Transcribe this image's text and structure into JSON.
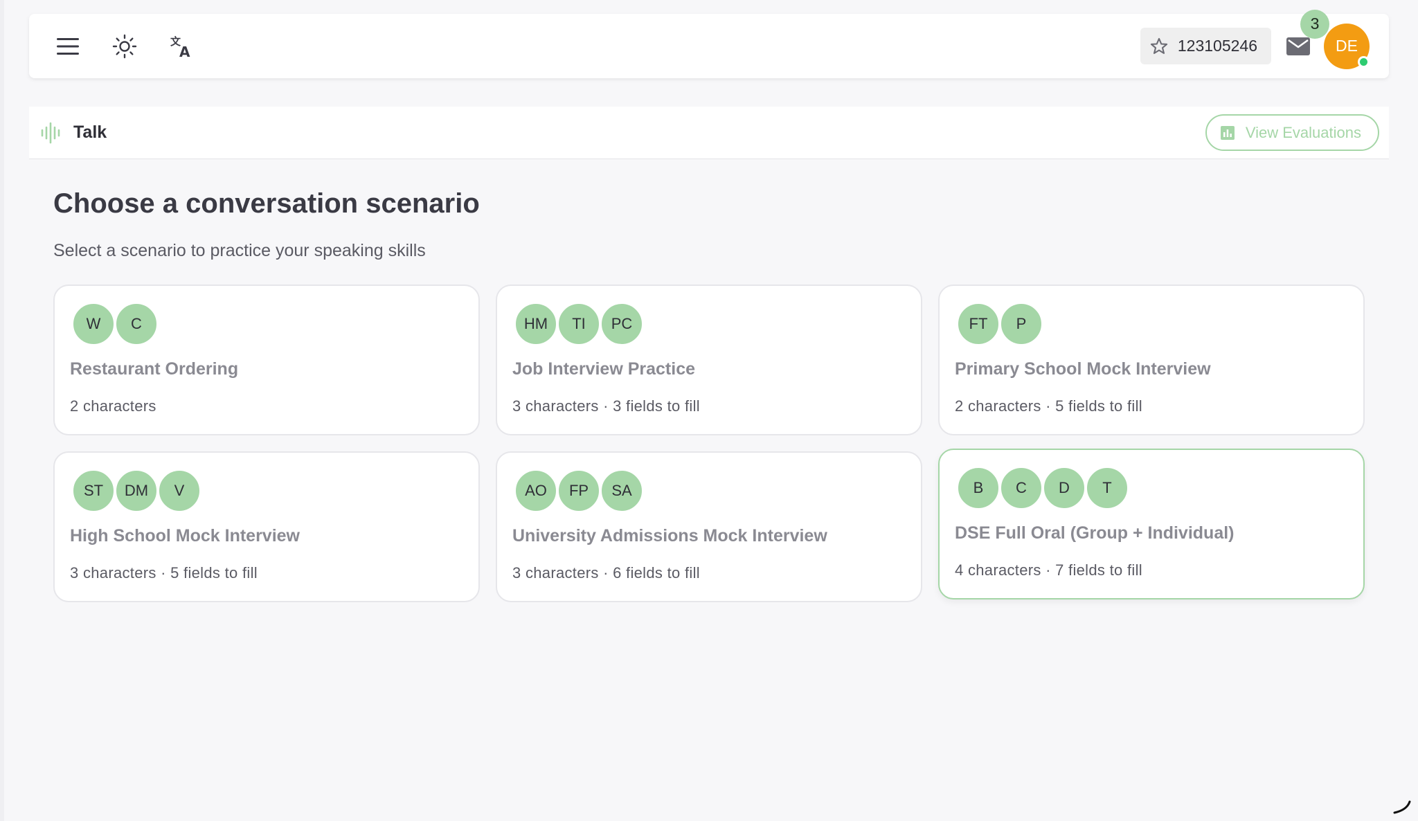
{
  "topbar": {
    "icons": {
      "menu": "menu-icon",
      "theme": "sun-icon",
      "language": "translate-icon",
      "star": "star-icon",
      "mail": "mail-icon"
    },
    "points": "123105246",
    "mail_badge": "3",
    "avatar_initials": "DE",
    "avatar_color": "#f39c12",
    "online_color": "#2ecc71"
  },
  "section": {
    "title": "Talk",
    "icon": "audio-wave-icon",
    "view_evaluations_label": "View Evaluations",
    "accent": "#a5d6a7"
  },
  "main": {
    "title": "Choose a conversation scenario",
    "subtitle": "Select a scenario to practice your speaking skills",
    "scenarios": [
      {
        "avatars": [
          "W",
          "C"
        ],
        "title": "Restaurant Ordering",
        "meta": "2 characters"
      },
      {
        "avatars": [
          "HM",
          "TI",
          "PC"
        ],
        "title": "Job Interview Practice",
        "meta": "3 characters · 3 fields to fill"
      },
      {
        "avatars": [
          "FT",
          "P"
        ],
        "title": "Primary School Mock Interview",
        "meta": "2 characters · 5 fields to fill"
      },
      {
        "avatars": [
          "ST",
          "DM",
          "V"
        ],
        "title": "High School Mock Interview",
        "meta": "3 characters · 5 fields to fill"
      },
      {
        "avatars": [
          "AO",
          "FP",
          "SA"
        ],
        "title": "University Admissions Mock Interview",
        "meta": "3 characters · 6 fields to fill"
      },
      {
        "avatars": [
          "B",
          "C",
          "D",
          "T"
        ],
        "title": "DSE Full Oral (Group + Individual)",
        "meta": "4 characters · 7 fields to fill",
        "selected": true
      }
    ]
  }
}
